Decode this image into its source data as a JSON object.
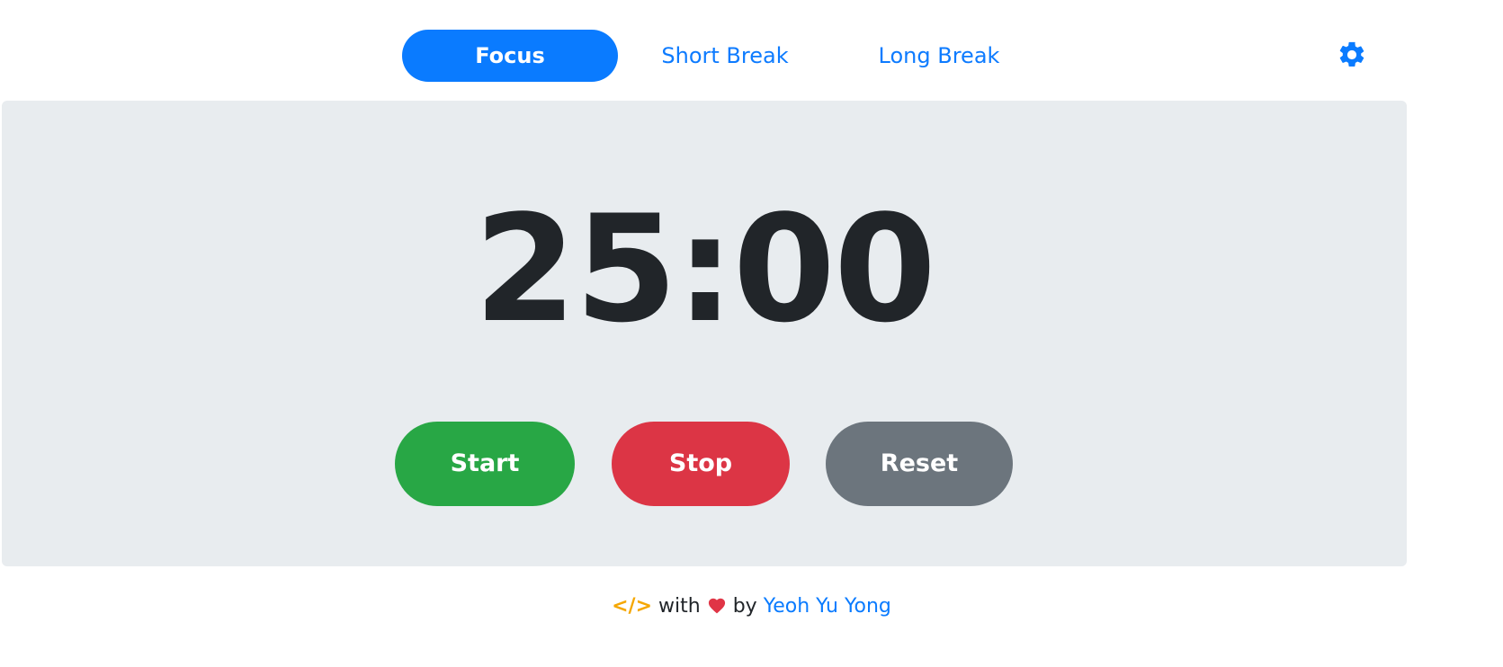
{
  "tabs": {
    "focus": "Focus",
    "short_break": "Short Break",
    "long_break": "Long Break",
    "active": "focus"
  },
  "settings": {
    "icon": "gear-icon"
  },
  "timer": {
    "display": "25:00"
  },
  "controls": {
    "start_label": "Start",
    "stop_label": "Stop",
    "reset_label": "Reset"
  },
  "footer": {
    "code_glyph": "</>",
    "with_text": "with",
    "by_text": "by",
    "author": "Yeoh Yu Yong"
  },
  "colors": {
    "accent": "#0a7bff",
    "start": "#28a745",
    "stop": "#dc3545",
    "reset": "#6c757d",
    "panel": "#e8ecef",
    "code_icon": "#f5a700",
    "heart": "#e03546"
  }
}
